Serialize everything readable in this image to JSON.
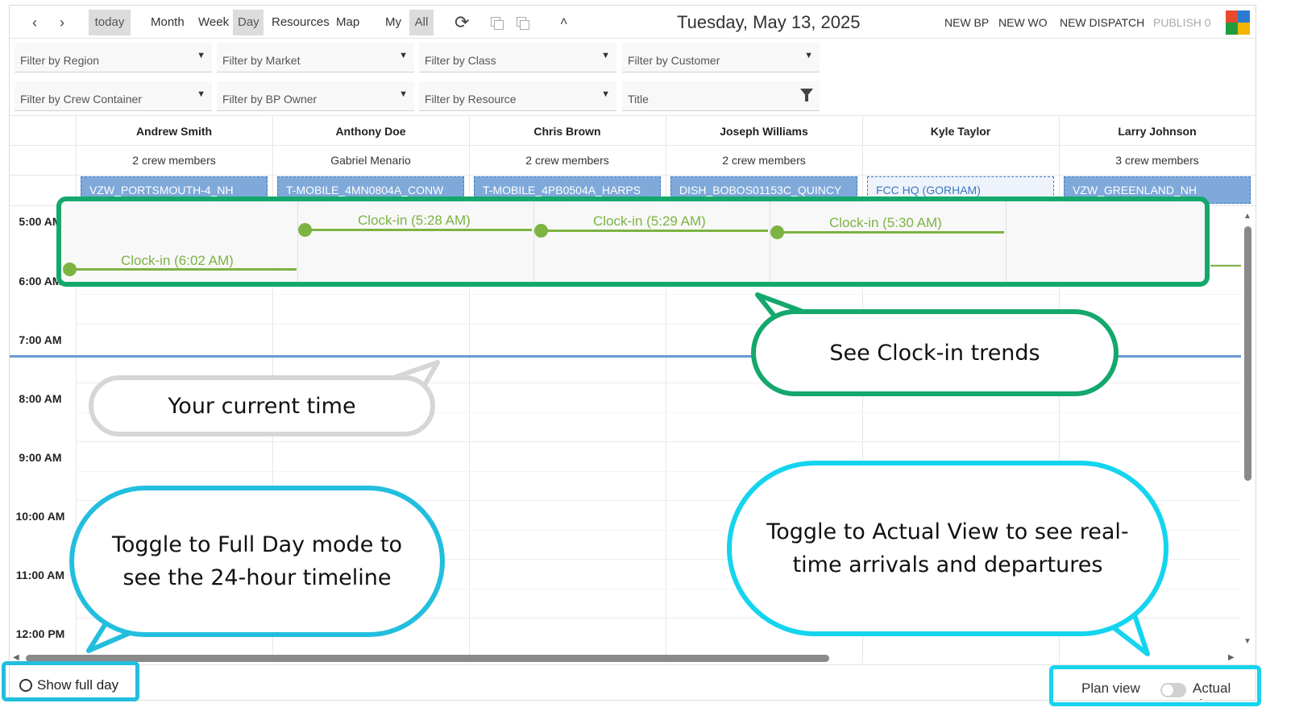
{
  "toolbar": {
    "prev": "‹",
    "next": "›",
    "today": "today",
    "views": [
      "Month",
      "Week",
      "Day",
      "Resources",
      "Map"
    ],
    "my": "My",
    "all": "All",
    "refresh": "⟳",
    "collapse": "˄",
    "date_title": "Tuesday, May 13, 2025",
    "actions": [
      "NEW BP",
      "NEW WO",
      "NEW DISPATCH",
      "PUBLISH 0"
    ]
  },
  "logo_colors": [
    "#e94a2f",
    "#2b7bd3",
    "#1f9c3c",
    "#f4b400"
  ],
  "filters": {
    "region": "Filter by Region",
    "market": "Filter by Market",
    "class": "Filter by Class",
    "customer": "Filter by Customer",
    "crew_container": "Filter by Crew Container",
    "bp_owner": "Filter by BP Owner",
    "resource": "Filter by Resource",
    "title": "Title"
  },
  "resources": [
    {
      "name": "Andrew Smith",
      "sub": "2 crew members",
      "job": "VZW_PORTSMOUTH-4_NH",
      "light": false
    },
    {
      "name": "Anthony Doe",
      "sub": "Gabriel Menario",
      "job": "T-MOBILE_4MN0804A_CONW",
      "light": false
    },
    {
      "name": "Chris Brown",
      "sub": "2 crew members",
      "job": "T-MOBILE_4PB0504A_HARPS",
      "light": false
    },
    {
      "name": "Joseph Williams",
      "sub": "2 crew members",
      "job": "DISH_BOBOS01153C_QUINCY",
      "light": false
    },
    {
      "name": "Kyle Taylor",
      "sub": "",
      "job": "FCC HQ (GORHAM)",
      "light": true
    },
    {
      "name": "Larry Johnson",
      "sub": "3 crew members",
      "job": "VZW_GREENLAND_NH",
      "light": false
    }
  ],
  "times": [
    "5:00 AM",
    "6:00 AM",
    "7:00 AM",
    "8:00 AM",
    "9:00 AM",
    "10:00 AM",
    "11:00 AM",
    "12:00 PM"
  ],
  "clockins": [
    "Clock-in (6:02 AM)",
    "Clock-in (5:28 AM)",
    "Clock-in (5:29 AM)",
    "Clock-in (5:30 AM)"
  ],
  "footer": {
    "show_full_day": "Show full day",
    "plan_view": "Plan view",
    "actual_view": "Actual view"
  },
  "callouts": {
    "clockin_trends": "See Clock-in trends",
    "current_time": "Your current time",
    "full_day": "Toggle to Full Day mode to see the 24-hour timeline",
    "actual_view": "Toggle to Actual View to see real-time arrivals and departures"
  },
  "colors": {
    "accent_green": "#14a86c",
    "clockin_green": "#7cb342",
    "callout_blue": "#23bede",
    "callout_cyan": "#14d4ee",
    "job_blue": "#7fa9d9",
    "current_time_line": "#6a9ad0"
  }
}
